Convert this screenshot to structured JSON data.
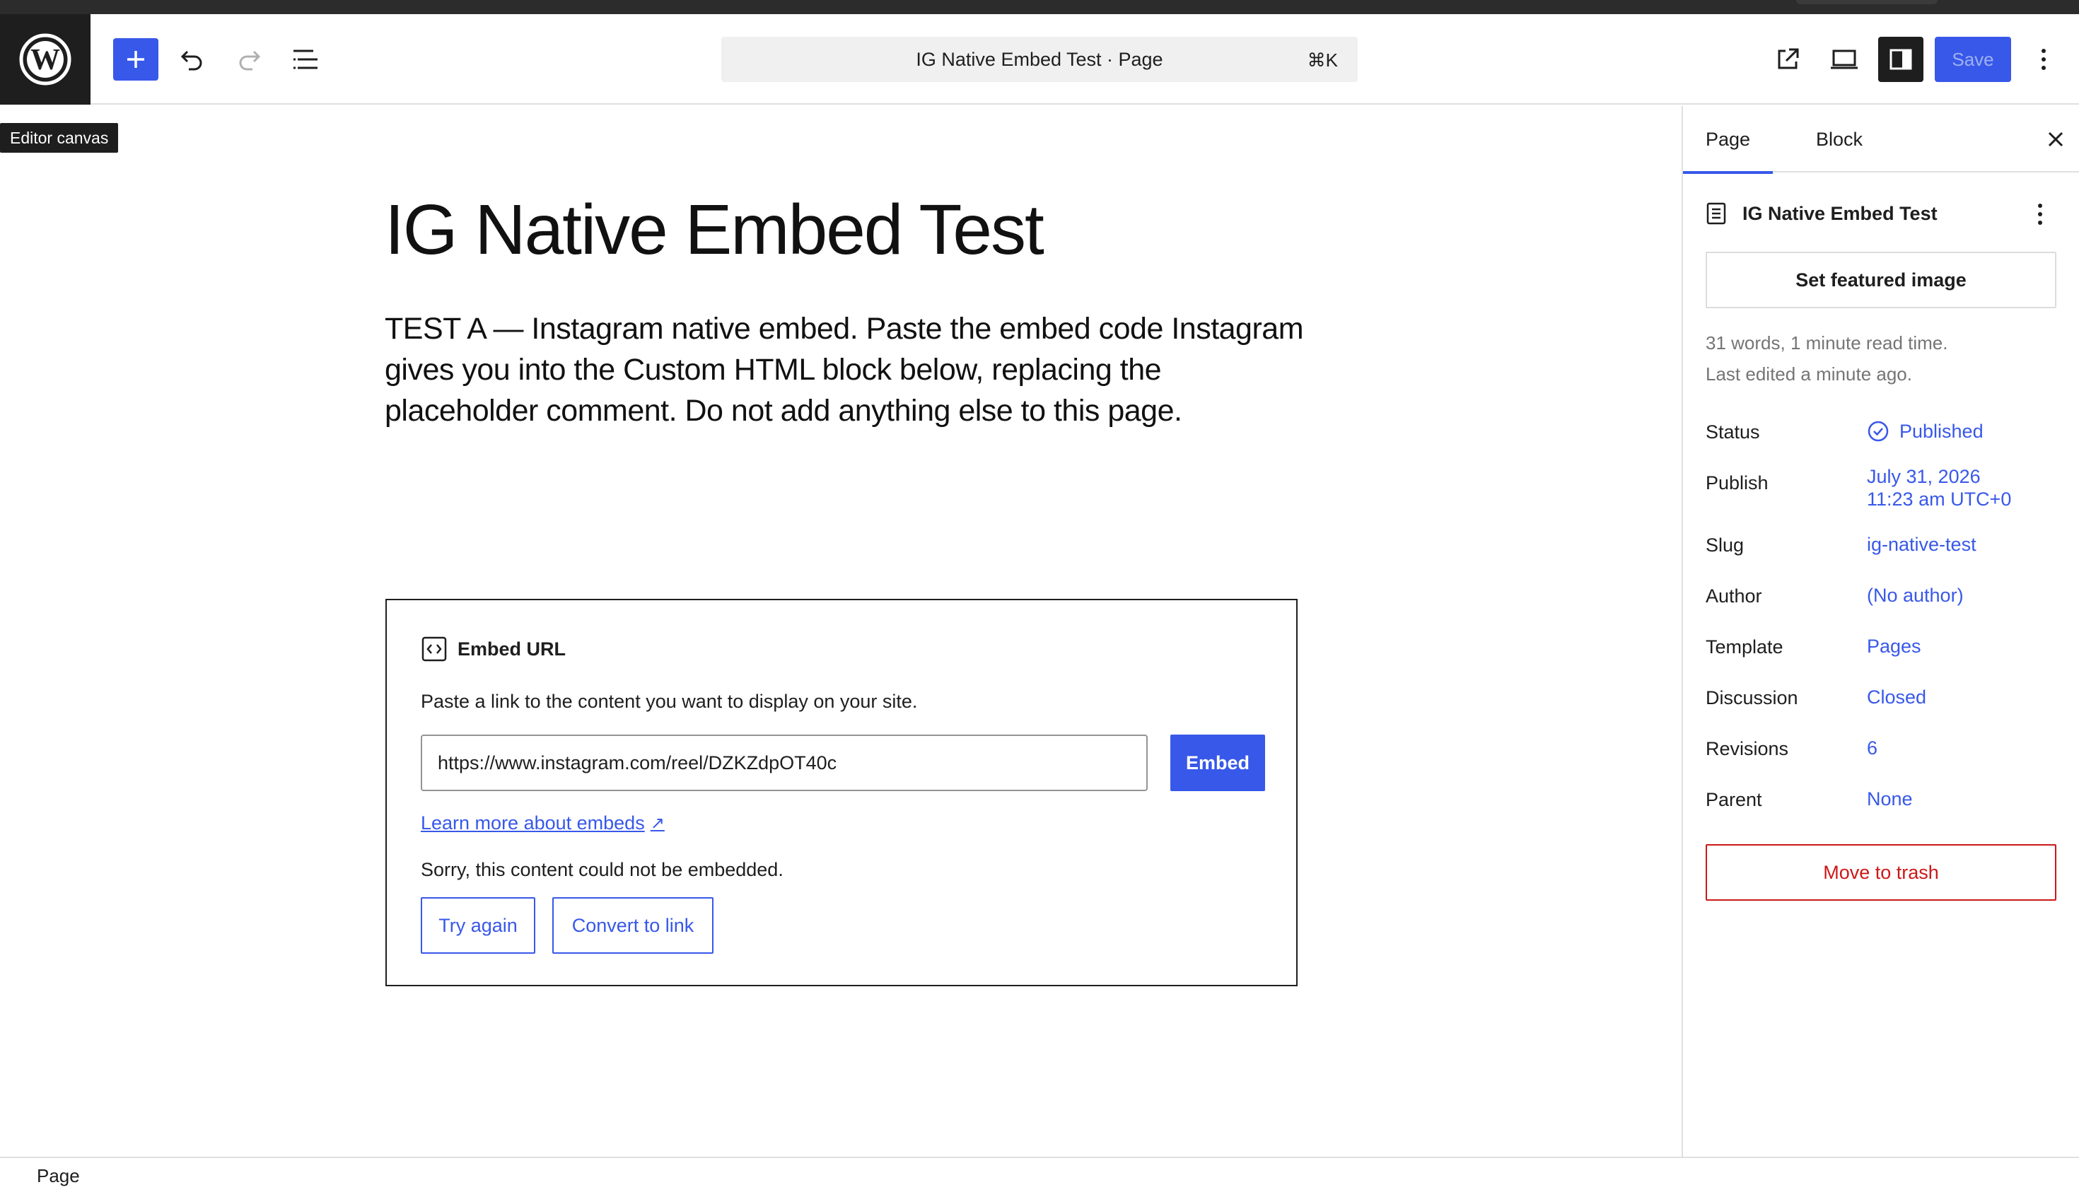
{
  "header": {
    "command_title": "IG Native Embed Test · Page",
    "command_shortcut": "⌘K",
    "save_label": "Save",
    "icons": [
      "wordpress-logo-icon",
      "plus-icon",
      "undo-icon",
      "redo-icon",
      "list-view-icon",
      "external-link-icon",
      "desktop-preview-icon",
      "sidebar-toggle-icon",
      "more-vertical-icon"
    ]
  },
  "tooltip": "Editor canvas",
  "editor": {
    "title": "IG Native Embed Test",
    "intro": "TEST A — Instagram native embed. Paste the embed code Instagram gives you into the Custom HTML block below, replacing the placeholder comment. Do not add anything else to this page.",
    "embed": {
      "heading": "Embed URL",
      "description": "Paste a link to the content you want to display on your site.",
      "url_value": "https://www.instagram.com/reel/DZKZdpOT40c",
      "submit_label": "Embed",
      "learn_more": "Learn more about embeds",
      "learn_more_arrow": "↗",
      "error": "Sorry, this content could not be embedded.",
      "try_again": "Try again",
      "convert_to_link": "Convert to link"
    }
  },
  "sidebar": {
    "tabs": [
      {
        "label": "Page",
        "active": true
      },
      {
        "label": "Block",
        "active": false
      }
    ],
    "doc_title": "IG Native Embed Test",
    "featured_image": "Set featured image",
    "meta_words": "31 words, 1 minute read time.",
    "meta_edited": "Last edited a minute ago.",
    "fields": {
      "status": {
        "label": "Status",
        "value": "Published"
      },
      "publish": {
        "label": "Publish",
        "value_line1": "July 31, 2026",
        "value_line2": "11:23 am UTC+0"
      },
      "slug": {
        "label": "Slug",
        "value": "ig-native-test"
      },
      "author": {
        "label": "Author",
        "value": "(No author)"
      },
      "template": {
        "label": "Template",
        "value": "Pages"
      },
      "discussion": {
        "label": "Discussion",
        "value": "Closed"
      },
      "revisions": {
        "label": "Revisions",
        "value": "6"
      },
      "parent": {
        "label": "Parent",
        "value": "None"
      }
    },
    "trash": "Move to trash"
  },
  "footer": {
    "breadcrumb": "Page"
  },
  "colors": {
    "accent": "#3858e9",
    "danger": "#cc1818",
    "dark": "#1e1e1e",
    "muted": "#757575"
  }
}
